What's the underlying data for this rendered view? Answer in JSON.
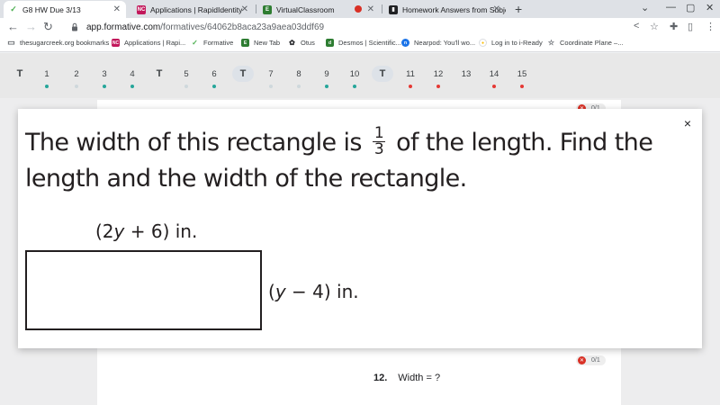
{
  "browser": {
    "tabs": [
      {
        "title": "G8 HW Due 3/13",
        "icon": "formative-check-icon",
        "color": "#4caf50",
        "active": true
      },
      {
        "title": "Applications | RapidIdentity",
        "icon": "rapididentity-icon",
        "color": "#c2185b",
        "active": false
      },
      {
        "title": "VirtualClassroom",
        "icon": "virtualclassroom-icon",
        "color": "#2e7d32",
        "active": false
      },
      {
        "title": "Homework Answers from Subje",
        "icon": "homework-icon",
        "color": "#202124",
        "active": false
      }
    ],
    "new_tab_glyph": "+",
    "url_host": "app.formative.com",
    "url_path": "/formatives/64062b8aca23a9aea03ddf69",
    "bookmarks": [
      {
        "label": "thesugarcreek.org bookmarks",
        "icon": "folder-icon"
      },
      {
        "label": "Applications | Rapi...",
        "icon": "rapididentity-icon"
      },
      {
        "label": "Formative",
        "icon": "formative-check-icon"
      },
      {
        "label": "New Tab",
        "icon": "newtab-icon"
      },
      {
        "label": "Otus",
        "icon": "otus-icon"
      },
      {
        "label": "Desmos | Scientific...",
        "icon": "desmos-icon"
      },
      {
        "label": "Nearpod: You'll wo...",
        "icon": "nearpod-icon"
      },
      {
        "label": "Log in to i-Ready",
        "icon": "iready-icon"
      },
      {
        "label": "Coordinate Plane –...",
        "icon": "coordinate-icon"
      }
    ]
  },
  "question_nav": [
    {
      "label": "T",
      "type": "teacher"
    },
    {
      "label": "1",
      "dot": "#26a69a"
    },
    {
      "label": "2",
      "dot": "#cfd8dc"
    },
    {
      "label": "3",
      "dot": "#26a69a"
    },
    {
      "label": "4",
      "dot": "#26a69a"
    },
    {
      "label": "T",
      "type": "teacher"
    },
    {
      "label": "5",
      "dot": "#cfd8dc"
    },
    {
      "label": "6",
      "dot": "#26a69a"
    },
    {
      "label": "T",
      "type": "teacher-pill"
    },
    {
      "label": "7",
      "dot": "#cfd8dc"
    },
    {
      "label": "8",
      "dot": "#cfd8dc"
    },
    {
      "label": "9",
      "dot": "#26a69a"
    },
    {
      "label": "10",
      "dot": "#26a69a"
    },
    {
      "label": "T",
      "type": "teacher-pill"
    },
    {
      "label": "11",
      "dot": "#e53935"
    },
    {
      "label": "12",
      "dot": "#e53935"
    },
    {
      "label": "13",
      "dot": null
    },
    {
      "label": "14",
      "dot": "#e53935"
    },
    {
      "label": "15",
      "dot": "#e53935"
    }
  ],
  "score_top": "0/1",
  "score_bottom": "0/1",
  "question12": {
    "number": "12.",
    "prompt": "Width = ?"
  },
  "modal": {
    "close_glyph": "×",
    "text_before": "The width of this rectangle is",
    "fraction_num": "1",
    "fraction_den": "3",
    "text_after": "of the length. Find the length and the width of the rectangle.",
    "length_open": "(2",
    "length_var": "y",
    "length_rest": " + 6) in.",
    "width_open": "(",
    "width_var": "y",
    "width_rest": " − 4) in."
  }
}
